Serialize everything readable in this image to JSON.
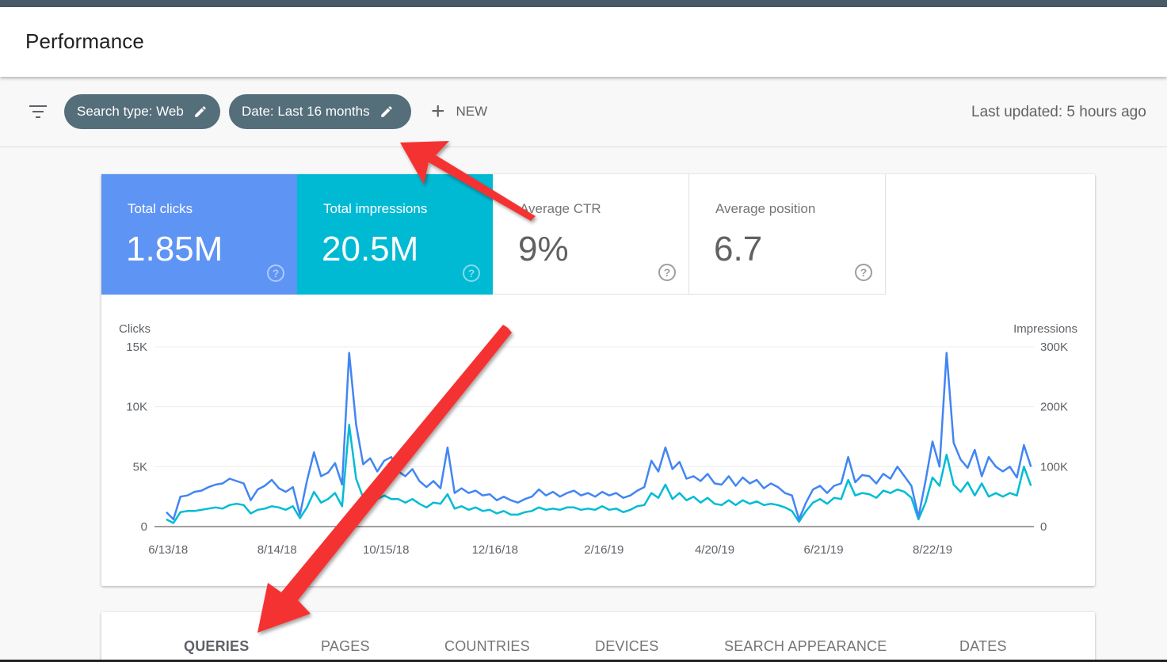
{
  "header": {
    "title": "Performance"
  },
  "filters": {
    "chips": [
      {
        "label": "Search type: Web",
        "icon": "pencil-icon"
      },
      {
        "label": "Date: Last 16 months",
        "icon": "pencil-icon"
      }
    ],
    "new_label": "NEW",
    "last_updated": "Last updated: 5 hours ago"
  },
  "metrics": [
    {
      "label": "Total clicks",
      "value": "1.85M",
      "selected": true,
      "color": "#5e94f4"
    },
    {
      "label": "Total impressions",
      "value": "20.5M",
      "selected": true,
      "color": "#00bad4"
    },
    {
      "label": "Average CTR",
      "value": "9%",
      "selected": false
    },
    {
      "label": "Average position",
      "value": "6.7",
      "selected": false
    }
  ],
  "help_glyph": "?",
  "tabs": [
    {
      "label": "QUERIES",
      "active": true
    },
    {
      "label": "PAGES",
      "active": false
    },
    {
      "label": "COUNTRIES",
      "active": false
    },
    {
      "label": "DEVICES",
      "active": false
    },
    {
      "label": "SEARCH APPEARANCE",
      "active": false
    },
    {
      "label": "DATES",
      "active": false
    }
  ],
  "chart_data": {
    "type": "line",
    "title": "",
    "ylabel": "Clicks",
    "y2label": "Impressions",
    "ylim": [
      0,
      15000
    ],
    "y2lim": [
      0,
      300000
    ],
    "yticks": [
      "0",
      "5K",
      "10K",
      "15K"
    ],
    "y2ticks": [
      "0",
      "100K",
      "200K",
      "300K"
    ],
    "xtick_labels": [
      "6/13/18",
      "8/14/18",
      "10/15/18",
      "12/16/18",
      "2/16/19",
      "4/20/19",
      "6/21/19",
      "8/22/19"
    ],
    "x_start_date": "6/12/18",
    "x_step_days": 4,
    "grid": true,
    "legend": "none",
    "series": [
      {
        "name": "Clicks",
        "axis": "left",
        "color": "#4285f4",
        "values": [
          1200,
          600,
          2500,
          2600,
          2900,
          3000,
          3300,
          3500,
          3600,
          4000,
          3800,
          3600,
          2200,
          3100,
          3400,
          3900,
          3200,
          2900,
          3300,
          1000,
          3800,
          6200,
          4200,
          4500,
          5300,
          3500,
          14500,
          8500,
          5200,
          5700,
          4600,
          5500,
          5800,
          4600,
          4200,
          4800,
          3800,
          3300,
          3800,
          3200,
          6600,
          2800,
          3200,
          2800,
          3000,
          2600,
          2700,
          2200,
          2500,
          2200,
          2000,
          2300,
          2500,
          3100,
          2600,
          2900,
          2500,
          2800,
          3000,
          2600,
          2800,
          2500,
          2900,
          2600,
          2800,
          2400,
          2600,
          3000,
          3300,
          5500,
          4600,
          6600,
          4800,
          5400,
          4000,
          4200,
          3800,
          4400,
          3600,
          3500,
          4200,
          3400,
          4100,
          3600,
          3900,
          3200,
          3600,
          3300,
          2800,
          2600,
          600,
          2000,
          3100,
          3400,
          2800,
          3400,
          3600,
          5800,
          3700,
          4300,
          4200,
          3600,
          4400,
          4000,
          5000,
          4200,
          3400,
          800,
          3800,
          7100,
          5000,
          14500,
          7000,
          5600,
          4900,
          6400,
          4200,
          5800,
          5000,
          4600,
          5000,
          4100,
          6800,
          5000
        ]
      },
      {
        "name": "Impressions",
        "axis": "right",
        "color": "#00bcd4",
        "values": [
          12000,
          6000,
          24000,
          26000,
          26000,
          28000,
          30000,
          32000,
          30000,
          36000,
          38000,
          36000,
          22000,
          28000,
          30000,
          34000,
          32000,
          28000,
          34000,
          14000,
          32000,
          58000,
          40000,
          46000,
          56000,
          34000,
          170000,
          80000,
          48000,
          54000,
          46000,
          52000,
          46000,
          46000,
          40000,
          46000,
          38000,
          32000,
          40000,
          38000,
          54000,
          30000,
          34000,
          28000,
          32000,
          26000,
          28000,
          22000,
          26000,
          20000,
          20000,
          24000,
          26000,
          32000,
          28000,
          30000,
          28000,
          32000,
          32000,
          28000,
          30000,
          28000,
          34000,
          28000,
          30000,
          24000,
          28000,
          34000,
          36000,
          56000,
          48000,
          70000,
          46000,
          56000,
          44000,
          50000,
          40000,
          48000,
          38000,
          36000,
          44000,
          36000,
          44000,
          38000,
          42000,
          36000,
          38000,
          36000,
          32000,
          26000,
          8000,
          26000,
          40000,
          46000,
          38000,
          48000,
          46000,
          78000,
          52000,
          56000,
          54000,
          48000,
          60000,
          56000,
          62000,
          58000,
          48000,
          12000,
          40000,
          82000,
          68000,
          120000,
          70000,
          58000,
          74000,
          52000,
          72000,
          50000,
          56000,
          50000,
          56000,
          52000,
          100000,
          68000
        ]
      }
    ]
  }
}
